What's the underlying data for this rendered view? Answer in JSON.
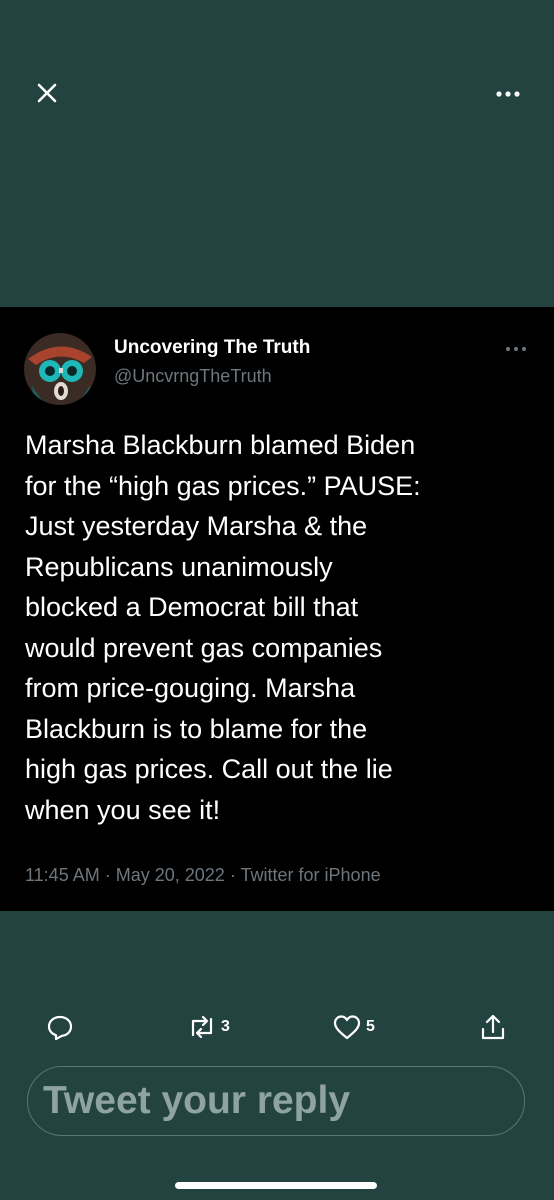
{
  "topbar": {
    "close_icon": "close-icon",
    "more_icon": "more-horizontal-icon"
  },
  "tweet": {
    "author_name": "Uncovering The Truth",
    "author_handle": "@UncvrngTheTruth",
    "text": "Marsha Blackburn blamed Biden\nfor the “high gas prices.” PAUSE:\nJust yesterday Marsha & the\nRepublicans unanimously\nblocked a Democrat bill that\nwould prevent gas companies\nfrom price-gouging. Marsha\nBlackburn is to blame for the\nhigh gas prices. Call out the lie\nwhen you see it!",
    "time": "11:45 AM",
    "date": "May 20, 2022",
    "source": "Twitter for iPhone",
    "separator": "·"
  },
  "actions": {
    "reply_icon": "reply-icon",
    "retweet_icon": "retweet-icon",
    "retweet_count": "3",
    "like_icon": "heart-icon",
    "like_count": "5",
    "share_icon": "share-icon"
  },
  "reply_bar": {
    "placeholder": "Tweet your reply"
  },
  "colors": {
    "background": "#234340",
    "card": "#000000",
    "text": "#ffffff",
    "muted": "#6e767d"
  }
}
